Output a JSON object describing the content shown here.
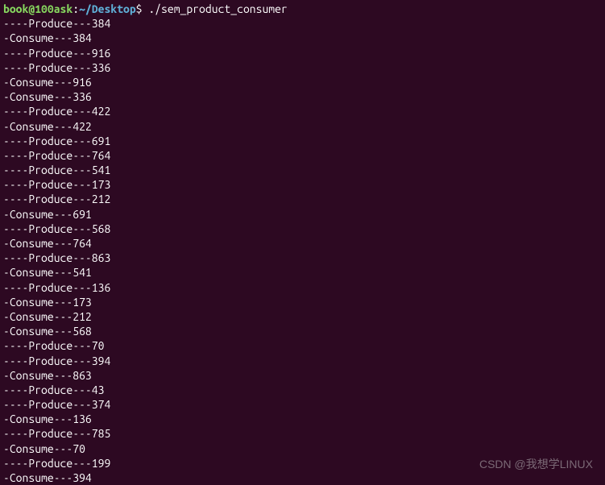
{
  "prompt": {
    "user_host": "book@100ask",
    "colon": ":",
    "path": "~/Desktop",
    "dollar": "$",
    "command": " ./sem_product_consumer"
  },
  "output": [
    "----Produce---384",
    "-Consume---384",
    "----Produce---916",
    "----Produce---336",
    "-Consume---916",
    "-Consume---336",
    "----Produce---422",
    "-Consume---422",
    "----Produce---691",
    "----Produce---764",
    "----Produce---541",
    "----Produce---173",
    "----Produce---212",
    "-Consume---691",
    "----Produce---568",
    "-Consume---764",
    "----Produce---863",
    "-Consume---541",
    "----Produce---136",
    "-Consume---173",
    "-Consume---212",
    "-Consume---568",
    "----Produce---70",
    "----Produce---394",
    "-Consume---863",
    "----Produce---43",
    "----Produce---374",
    "-Consume---136",
    "----Produce---785",
    "-Consume---70",
    "----Produce---199",
    "-Consume---394"
  ],
  "watermark": "CSDN @我想学LINUX"
}
